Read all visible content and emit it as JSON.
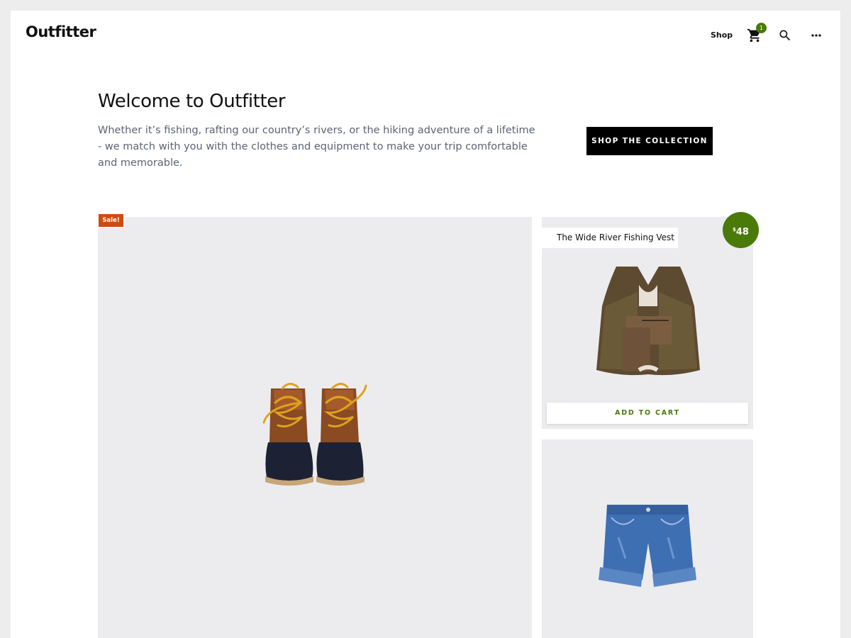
{
  "header": {
    "site_title": "Outfitter",
    "nav_shop": "Shop",
    "cart_count": "1",
    "icons": [
      "cart-icon",
      "search-icon",
      "more-icon"
    ]
  },
  "hero": {
    "title": "Welcome to Outfitter",
    "text": "Whether it’s fishing, rafting our country’s rivers, or the hiking adventure of a lifetime - we match with you with the clothes and equipment to make your trip comfortable and memorable.",
    "button_label": "SHOP THE COLLECTION"
  },
  "products": [
    {
      "image": "boots",
      "badge": "Sale!"
    },
    {
      "image": "fishing-vest",
      "name": "The Wide River Fishing Vest",
      "price_symbol": "$",
      "price_value": "48",
      "add_to_cart_label": "ADD TO CART"
    },
    {
      "image": "denim-shorts"
    }
  ],
  "colors": {
    "accent_green": "#4a7a08",
    "sale_orange": "#d24a0b",
    "card_bg": "#ececef",
    "page_bg": "#ededed"
  }
}
